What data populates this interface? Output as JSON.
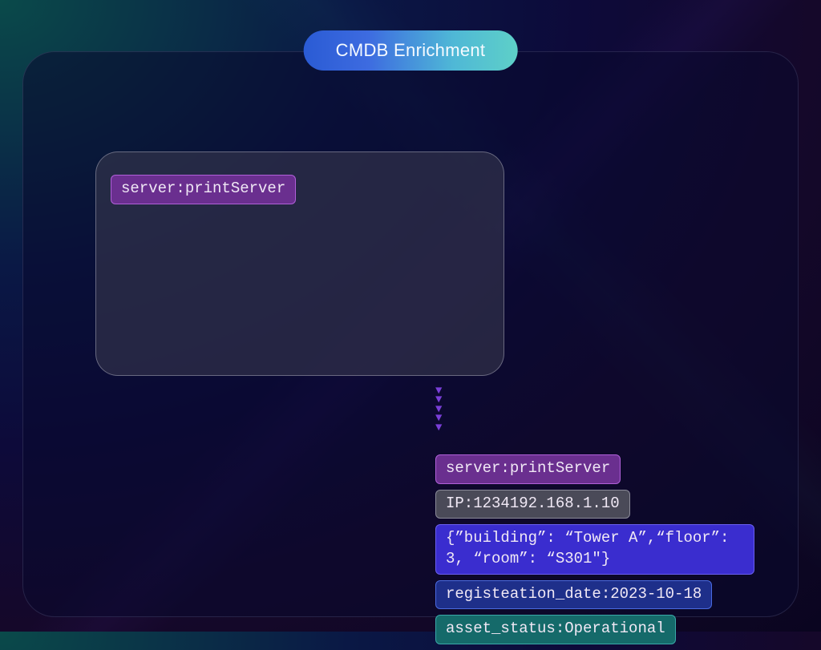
{
  "title": "CMDB Enrichment",
  "input": {
    "server_tag": "server:printServer"
  },
  "arrow_count": 5,
  "output": {
    "server_tag": "server:printServer",
    "ip_tag": "IP:1234192.168.1.10",
    "location_tag": "{”building”: “Tower A”,“floor”: 3, “room”: “S301\"}",
    "registration_tag": "registeation_date:2023-10-18",
    "status_tag": "asset_status:Operational"
  }
}
